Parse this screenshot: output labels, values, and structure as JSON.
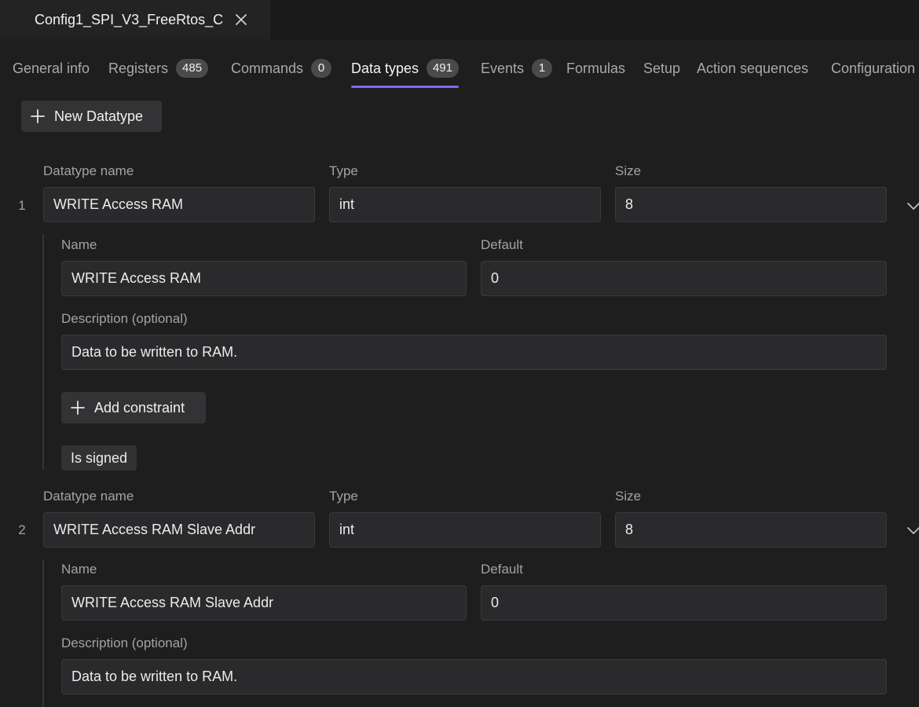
{
  "window": {
    "file_tab_title": "Config1_SPI_V3_FreeRtos_C"
  },
  "nav": {
    "tabs": [
      {
        "label": "General info"
      },
      {
        "label": "Registers",
        "badge": "485"
      },
      {
        "label": "Commands",
        "badge": "0"
      },
      {
        "label": "Data types",
        "badge": "491",
        "active": true
      },
      {
        "label": "Events",
        "badge": "1"
      },
      {
        "label": "Formulas"
      },
      {
        "label": "Setup"
      },
      {
        "label": "Action sequences"
      },
      {
        "label": "Configuration"
      }
    ]
  },
  "toolbar": {
    "new_datatype_label": "New Datatype"
  },
  "labels": {
    "datatype_name": "Datatype name",
    "type": "Type",
    "size": "Size",
    "name": "Name",
    "default": "Default",
    "description": "Description (optional)",
    "add_constraint": "Add constraint",
    "is_signed": "Is signed"
  },
  "datatypes": [
    {
      "index": "1",
      "datatype_name": "WRITE Access RAM",
      "type": "int",
      "size": "8",
      "name": "WRITE Access RAM",
      "default": "0",
      "description": "Data to be written to RAM."
    },
    {
      "index": "2",
      "datatype_name": "WRITE Access RAM Slave Addr",
      "type": "int",
      "size": "8",
      "name": "WRITE Access RAM Slave Addr",
      "default": "0",
      "description": "Data to be written to RAM."
    }
  ],
  "icons": {
    "close": "close-icon",
    "plus": "plus-icon",
    "chevron": "chevron-down-icon"
  },
  "colors": {
    "accent": "#7b6cf0",
    "background": "#1e1e1f",
    "field": "#2a2a2c"
  }
}
